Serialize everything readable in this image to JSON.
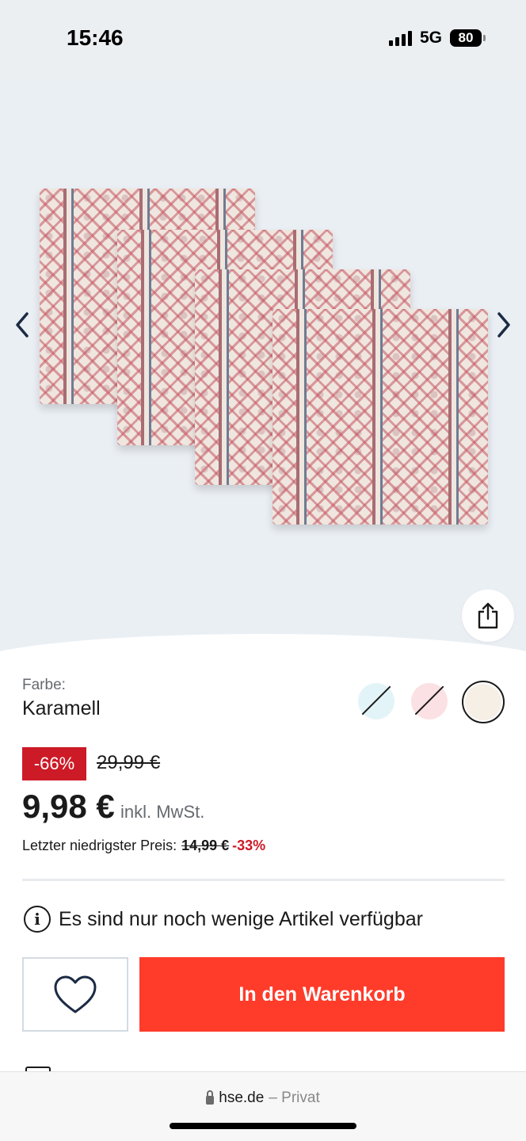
{
  "status_bar": {
    "time": "15:46",
    "network": "5G",
    "battery": "80"
  },
  "product_gallery": {
    "image_alt": "Platzsets Karamell"
  },
  "color": {
    "label": "Farbe:",
    "selected": "Karamell",
    "swatches": [
      {
        "name": "light blue",
        "hex": "#e3f4f8",
        "available": false
      },
      {
        "name": "pink",
        "hex": "#fbe1e3",
        "available": false
      },
      {
        "name": "Karamell",
        "hex": "#f6efe6",
        "available": true,
        "selected": true
      }
    ]
  },
  "pricing": {
    "discount_badge": "-66%",
    "old_price": "29,99 €",
    "current_price": "9,98 €",
    "tax_note": "inkl. MwSt.",
    "lowest_label": "Letzter niedrigster Preis:",
    "lowest_price": "14,99 €",
    "lowest_pct": "-33%"
  },
  "availability": {
    "text": "Es sind nur noch wenige Artikel verfügbar"
  },
  "actions": {
    "add_to_cart": "In den Warenkorb"
  },
  "browser": {
    "domain": "hse.de",
    "mode": "– Privat"
  },
  "colors": {
    "accent": "#ff3b2a",
    "sale_red": "#cc1a27",
    "stage_bg": "#eaeff4"
  }
}
